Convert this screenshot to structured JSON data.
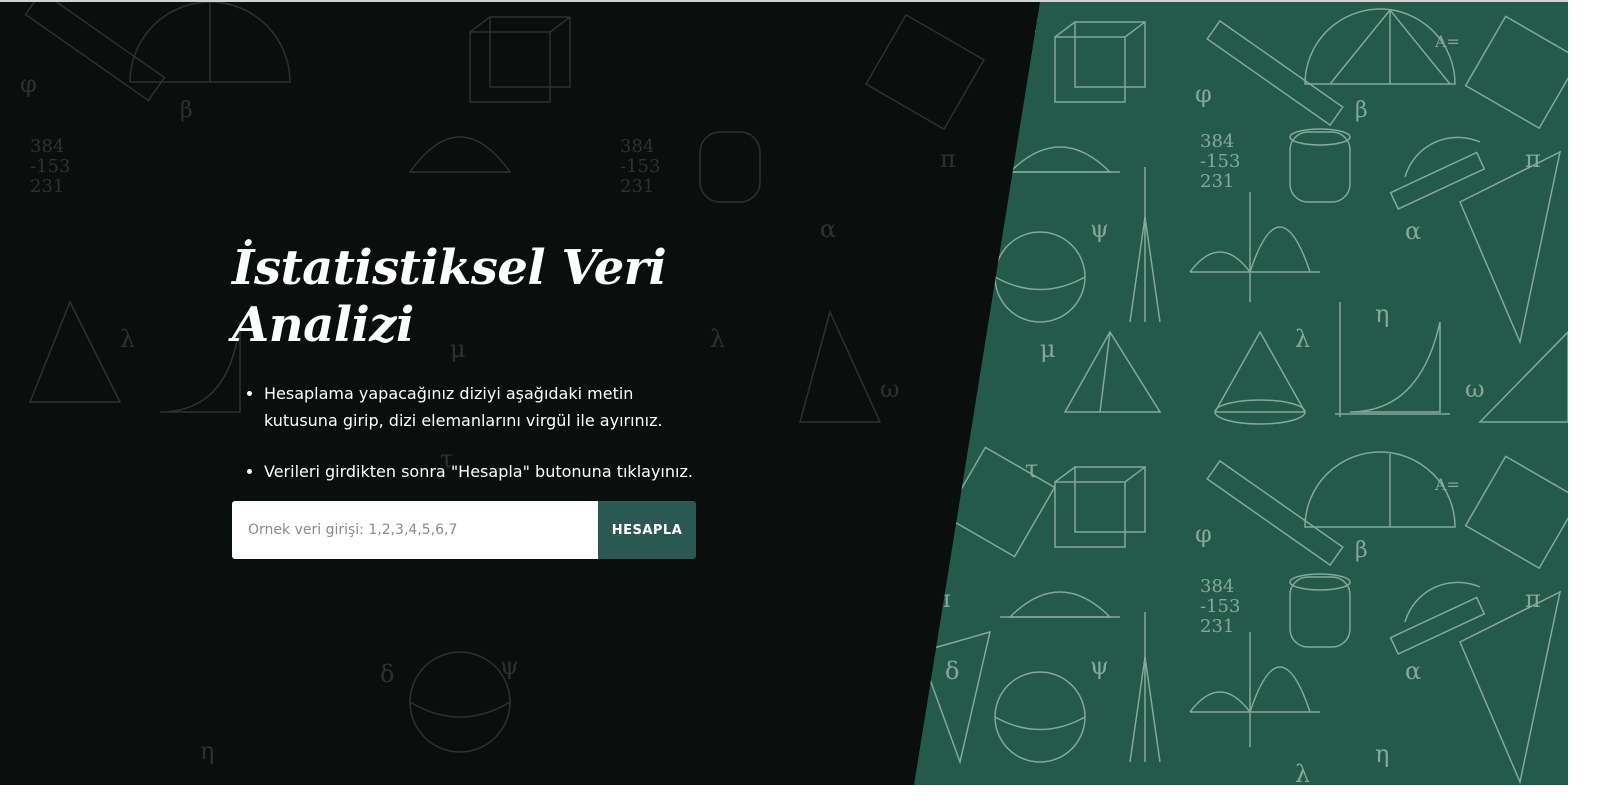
{
  "hero": {
    "title": "İstatistiksel Veri Analizi",
    "instructions": [
      "Hesaplama yapacağınız diziyi aşağıdaki metin kutusuna girip, dizi elemanlarını virgül ile ayırınız.",
      "Verileri girdikten sonra \"Hesapla\" butonuna tıklayınız."
    ]
  },
  "form": {
    "input_value": "",
    "input_placeholder": "Örnek veri girişi: 1,2,3,4,5,6,7",
    "button_label": "HESAPLA"
  },
  "colors": {
    "dark_background": "#0a0f0e",
    "chalkboard_green": "#235a49",
    "button": "#2c5854",
    "text": "#ffffff"
  }
}
